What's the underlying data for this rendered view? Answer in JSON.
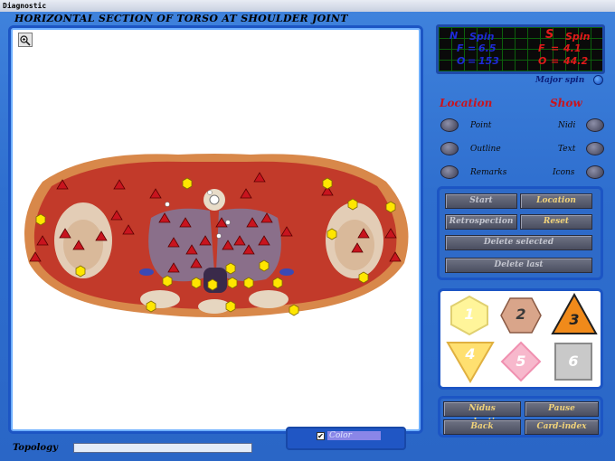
{
  "window": {
    "title": "Diagnostic"
  },
  "image_panel": {
    "title": "HORIZONTAL SECTION OF TORSO AT SHOULDER JOINT",
    "zoom_icon": "magnifier-icon"
  },
  "spin": {
    "north_letter": "N",
    "north_label": "Spin",
    "north_f_label": "F",
    "north_f_value": "6.5",
    "north_o_label": "O",
    "north_o_value": "153",
    "south_letter": "S",
    "south_label": "Spin",
    "south_f_label": "F",
    "south_f_value": "4.1",
    "south_o_label": "O",
    "south_o_value": "44.2",
    "eq": "=",
    "major_label": "Major spin"
  },
  "location": {
    "header": "Location",
    "items": [
      "Point",
      "Outline",
      "Remarks"
    ]
  },
  "show": {
    "header": "Show",
    "items": [
      "Nidi",
      "Text",
      "Icons"
    ]
  },
  "controls": {
    "start": "Start",
    "location": "Location",
    "retrospection": "Retrospection",
    "reset": "Reset",
    "delete_selected": "Delete selected",
    "delete_last": "Delete last"
  },
  "shapes": [
    {
      "num": "1",
      "kind": "hexagon",
      "color": "#fff59a"
    },
    {
      "num": "2",
      "kind": "hexagon",
      "color": "#d9a58a"
    },
    {
      "num": "3",
      "kind": "triangle-up",
      "color": "#f08a1a"
    },
    {
      "num": "4",
      "kind": "triangle-down",
      "color": "#ffe070"
    },
    {
      "num": "5",
      "kind": "diamond",
      "color": "#f7b8cc"
    },
    {
      "num": "6",
      "kind": "square",
      "color": "#c9c9c9"
    }
  ],
  "bottom_buttons": {
    "nidus_evaluation": "Nidus evaluation",
    "pause": "Pause",
    "back": "Back",
    "card_index": "Card-index"
  },
  "topology": {
    "label": "Topology"
  },
  "color_toggle": {
    "label": "Color",
    "checked": true
  },
  "colors": {
    "accent_blue": "#1c55c4",
    "marker_triangle": "#c8141e",
    "marker_hexagon": "#ffe600"
  }
}
